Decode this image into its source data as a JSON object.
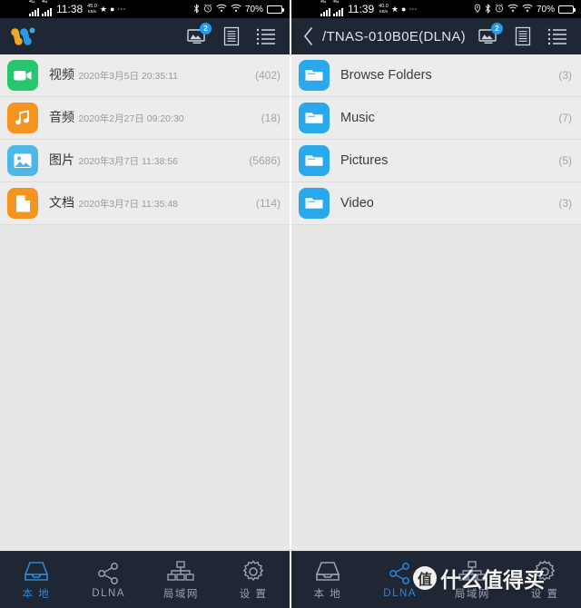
{
  "left_panel": {
    "status_bar": {
      "network_type_1": "4G",
      "network_type_2": "4G",
      "time": "11:38",
      "speed_value": "45.0",
      "speed_unit": "KB/s",
      "star_icon": "star-icon",
      "dot_icon": "circle-icon",
      "more_icon": "ellipsis-icon",
      "bluetooth_icon": "bluetooth-icon",
      "alarm_icon": "alarm-clock-icon",
      "wifi_icon_1": "wifi-icon",
      "wifi_icon_2": "wifi-icon",
      "battery_percent": "70%"
    },
    "appbar": {
      "logo_name": "app-logo",
      "cast_badge": "2",
      "icons": [
        "cast-screen-icon",
        "document-list-icon",
        "list-view-icon"
      ]
    },
    "items": [
      {
        "title": "视频",
        "subtitle": "2020年3月5日 20:35:11",
        "count": "(402)",
        "icon": "video-camera-icon",
        "color": "#28c76f"
      },
      {
        "title": "音频",
        "subtitle": "2020年2月27日 09:20:30",
        "count": "(18)",
        "icon": "music-note-icon",
        "color": "#f5941f"
      },
      {
        "title": "图片",
        "subtitle": "2020年3月7日 11:38:56",
        "count": "(5686)",
        "icon": "image-icon",
        "color": "#4bb8e8"
      },
      {
        "title": "文档",
        "subtitle": "2020年3月7日 11:35:48",
        "count": "(114)",
        "icon": "document-icon",
        "color": "#f5941f"
      }
    ],
    "bottom_nav": [
      {
        "label": "本 地",
        "icon": "inbox-icon",
        "active": true
      },
      {
        "label": "DLNA",
        "icon": "share-nodes-icon",
        "active": false
      },
      {
        "label": "局域网",
        "icon": "network-icon",
        "active": false
      },
      {
        "label": "设 置",
        "icon": "gear-icon",
        "active": false
      }
    ]
  },
  "right_panel": {
    "status_bar": {
      "network_type_1": "4G",
      "network_type_2": "4G",
      "time": "11:39",
      "speed_value": "40.0",
      "speed_unit": "KB/s",
      "star_icon": "star-icon",
      "dot_icon": "circle-icon",
      "more_icon": "ellipsis-icon",
      "location_icon": "location-pin-icon",
      "bluetooth_icon": "bluetooth-icon",
      "alarm_icon": "alarm-clock-icon",
      "wifi_icon_1": "wifi-icon",
      "wifi_icon_2": "wifi-icon",
      "battery_percent": "70%"
    },
    "appbar": {
      "back_icon": "back-chevron-icon",
      "title": "/TNAS-010B0E(DLNA)",
      "cast_badge": "2",
      "icons": [
        "cast-screen-icon",
        "document-list-icon",
        "list-view-icon"
      ]
    },
    "items": [
      {
        "title": "Browse Folders",
        "count": "(3)",
        "icon": "folder-icon",
        "color": "#2aa8ec"
      },
      {
        "title": "Music",
        "count": "(7)",
        "icon": "folder-icon",
        "color": "#2aa8ec"
      },
      {
        "title": "Pictures",
        "count": "(5)",
        "icon": "folder-icon",
        "color": "#2aa8ec"
      },
      {
        "title": "Video",
        "count": "(3)",
        "icon": "folder-icon",
        "color": "#2aa8ec"
      }
    ],
    "bottom_nav": [
      {
        "label": "本 地",
        "icon": "inbox-icon",
        "active": false
      },
      {
        "label": "DLNA",
        "icon": "share-nodes-icon",
        "active": true
      },
      {
        "label": "局域网",
        "icon": "network-icon",
        "active": false
      },
      {
        "label": "设 置",
        "icon": "gear-icon",
        "active": false
      }
    ]
  },
  "watermark": {
    "badge_char": "值",
    "text": "什么值得买"
  },
  "colors": {
    "appbar_bg": "#1f2634",
    "accent_blue": "#2e87d8",
    "list_bg": "#e7e7e7",
    "row_bg": "#ececec"
  }
}
